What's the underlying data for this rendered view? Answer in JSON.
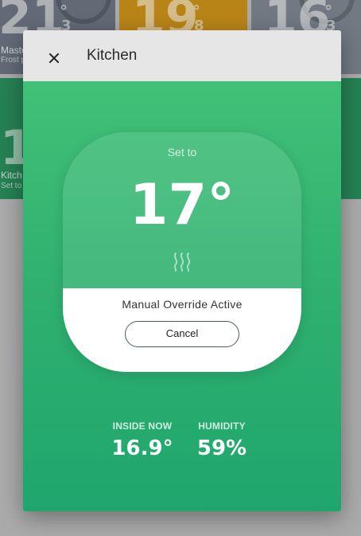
{
  "background_tiles": [
    {
      "temp": "21",
      "decimal": "3",
      "name": "Maste",
      "status": "Frost p"
    },
    {
      "temp": "19",
      "decimal": "8"
    },
    {
      "temp": "16",
      "decimal": "3"
    },
    {
      "temp": "1",
      "name": "Kitch",
      "status": "Set to"
    }
  ],
  "dialog": {
    "title": "Kitchen",
    "set_to_label": "Set to",
    "setpoint": "17°",
    "override_status": "Manual Override Active",
    "cancel_label": "Cancel",
    "readings": {
      "inside_label": "INSIDE NOW",
      "inside_value": "16.9°",
      "humidity_label": "HUMIDITY",
      "humidity_value": "59%"
    }
  },
  "icons": {
    "close": "close-icon",
    "heat": "heat-waves-icon"
  },
  "colors": {
    "accent": "#2fb06f",
    "header": "#e6e6e6",
    "tile_amber": "#c9901a",
    "tile_green": "#2a8d5c"
  }
}
